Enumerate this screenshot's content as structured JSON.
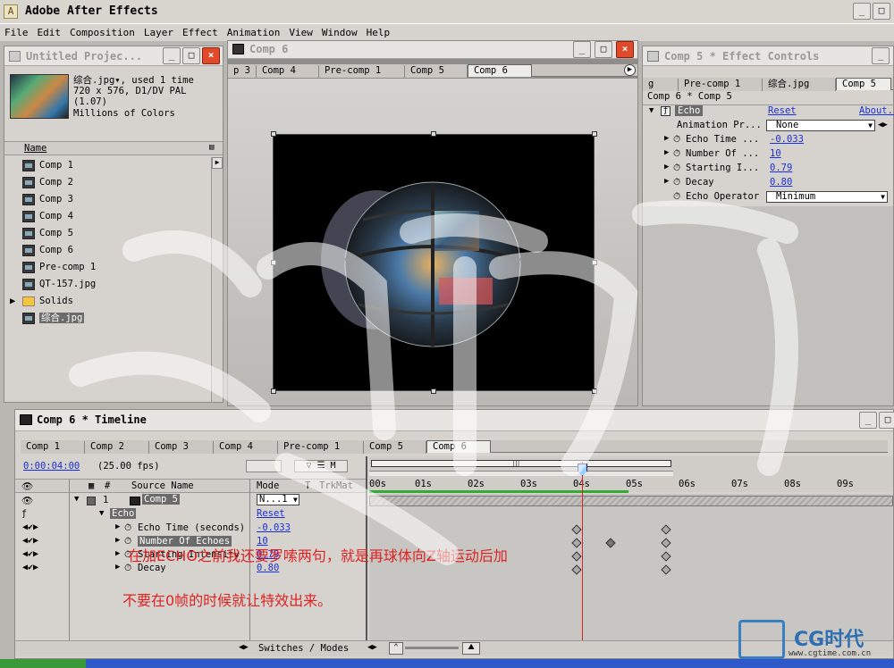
{
  "app": {
    "title": "Adobe After Effects",
    "window_buttons": [
      "_",
      "□",
      "×"
    ]
  },
  "menu": [
    "File",
    "Edit",
    "Composition",
    "Layer",
    "Effect",
    "Animation",
    "View",
    "Window",
    "Help"
  ],
  "project": {
    "title": "Untitled Projec...",
    "info_line1": "综合.jpg▾, used 1 time",
    "info_line2": "720 x 576, D1/DV PAL (1.07)",
    "info_line3": "Millions of Colors",
    "col_name": "Name",
    "items": [
      "Comp 1",
      "Comp 2",
      "Comp 3",
      "Comp 4",
      "Comp 5",
      "Comp 6",
      "Pre-comp 1",
      "QT-157.jpg",
      "Solids",
      "综合.jpg"
    ]
  },
  "viewer": {
    "title": "Comp 6",
    "tabs": [
      "p 3",
      "Comp 4",
      "Pre-comp 1",
      "Comp 5",
      "Comp 6"
    ]
  },
  "effects": {
    "title": "Comp 5 * Effect Controls",
    "tabs": [
      "g",
      "Pre-comp 1",
      "综合.jpg",
      "Comp 5"
    ],
    "subtitle": "Comp 6 * Comp 5",
    "effect_name": "Echo",
    "reset": "Reset",
    "about": "About...",
    "props": [
      {
        "label": "Animation Pr...",
        "value": "None"
      },
      {
        "label": "Echo Time ...",
        "value": "-0.033"
      },
      {
        "label": "Number Of ...",
        "value": "10"
      },
      {
        "label": "Starting I...",
        "value": "0.79"
      },
      {
        "label": "Decay",
        "value": "0.80"
      },
      {
        "label": "Echo Operator",
        "value": "Minimum"
      }
    ]
  },
  "timeline": {
    "title": "Comp 6 * Timeline",
    "tabs": [
      "Comp 1",
      "Comp 2",
      "Comp 3",
      "Comp 4",
      "Pre-comp 1",
      "Comp 5",
      "Comp 6"
    ],
    "timecode": "0:00:04:00",
    "fps": "(25.00 fps)",
    "cols": {
      "num": "#",
      "source": "Source Name",
      "mode": "Mode",
      "t": "T",
      "trkmat": "TrkMat"
    },
    "ruler": [
      "00s",
      "01s",
      "02s",
      "03s",
      "04s",
      "05s",
      "06s",
      "07s",
      "08s",
      "09s"
    ],
    "layer": {
      "num": "1",
      "name": "Comp 5",
      "mode": "N...1"
    },
    "effect": "Echo",
    "reset": "Reset",
    "props": [
      {
        "label": "Echo Time (seconds)",
        "value": "-0.033"
      },
      {
        "label": "Number Of Echoes",
        "value": "10"
      },
      {
        "label": "Starting Intensity",
        "value": "0.79"
      },
      {
        "label": "Decay",
        "value": "0.80"
      }
    ],
    "footer": "Switches / Modes"
  },
  "annotation": {
    "line1": "在加ECHO之前我还要罗嗦两句，就是再球体向Z轴运动后加",
    "line2": "不要在0帧的时候就让特效出来。"
  },
  "logo": {
    "brand": "CG时代",
    "url": "www.cgtime.com.cn"
  }
}
